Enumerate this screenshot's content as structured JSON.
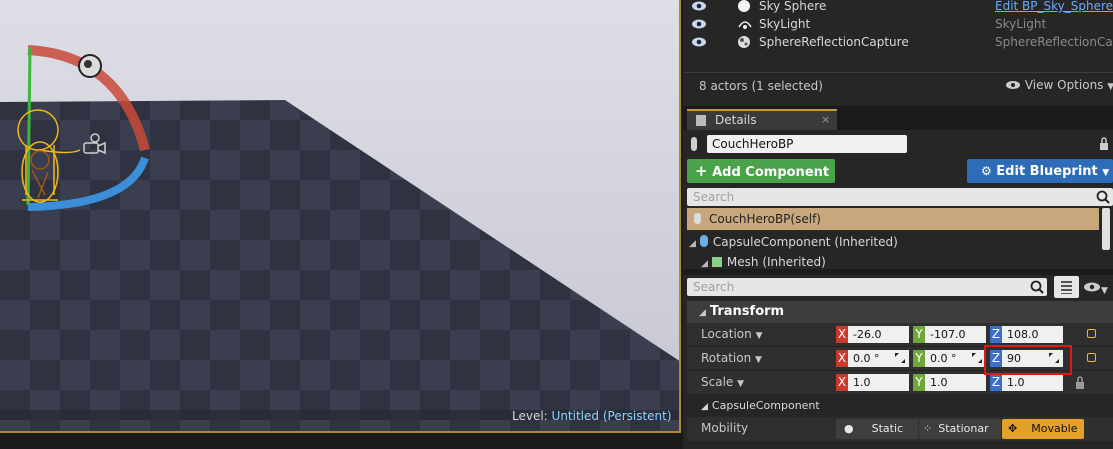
{
  "viewport": {
    "level_label": "Level:",
    "level_name": "Untitled (Persistent)"
  },
  "outliner": {
    "rows": [
      {
        "name": "Sky Sphere",
        "type": "Edit BP_Sky_Sphere",
        "icon": "sphere-icon"
      },
      {
        "name": "SkyLight",
        "type": "SkyLight",
        "icon": "skylight-icon"
      },
      {
        "name": "SphereReflectionCapture",
        "type": "SphereReflectionCapt",
        "icon": "reflection-capture-icon"
      }
    ],
    "count": "8 actors (1 selected)",
    "view_options": "View Options"
  },
  "details": {
    "tab_label": "Details",
    "tab_close": "×",
    "actor_name": "CouchHeroBP",
    "add_component": "Add Component",
    "edit_blueprint": "Edit Blueprint",
    "search_placeholder": "Search",
    "self_item": "CouchHeroBP(self)",
    "tree": [
      {
        "label": "CapsuleComponent (Inherited)"
      },
      {
        "label": "Mesh (Inherited)"
      }
    ],
    "section": "Transform",
    "location": {
      "label": "Location",
      "x": "-26.0",
      "y": "-107.0",
      "z": "108.0"
    },
    "rotation": {
      "label": "Rotation",
      "x": "0.0 °",
      "y": "0.0 °",
      "z": "90"
    },
    "scale": {
      "label": "Scale",
      "x": "1.0",
      "y": "1.0",
      "z": "1.0"
    },
    "axis_x": "X",
    "axis_y": "Y",
    "axis_z": "Z",
    "component_section": "CapsuleComponent",
    "mobility": {
      "label": "Mobility",
      "options": [
        "Static",
        "Stationar",
        "Movable"
      ],
      "selected": "Movable"
    }
  },
  "colors": {
    "accent": "#c69a34",
    "add_component": "#4aa34a",
    "edit_blueprint": "#2f6cb8",
    "selection": "#c8a77d",
    "highlight_box": "#e01818"
  }
}
